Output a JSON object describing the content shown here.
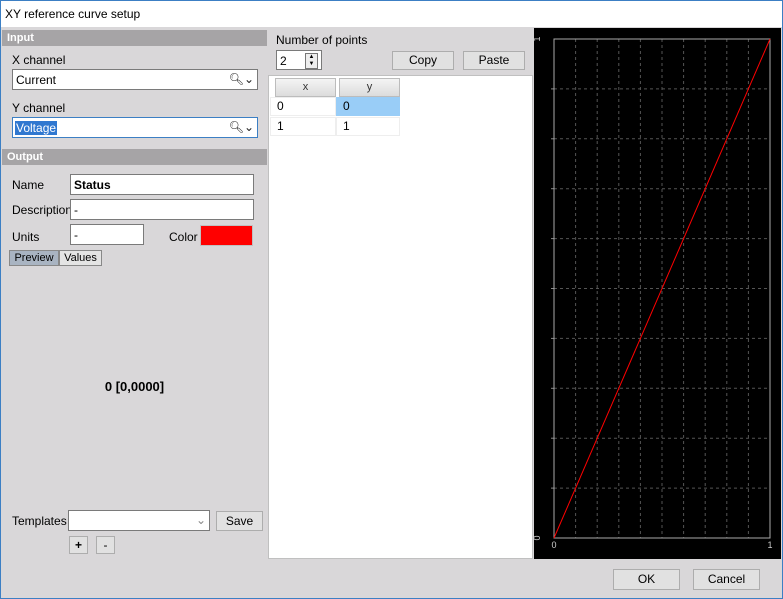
{
  "window": {
    "title": "XY reference curve setup"
  },
  "input_section": {
    "header": "Input",
    "x_channel": {
      "label": "X channel",
      "value": "Current"
    },
    "y_channel": {
      "label": "Y channel",
      "value": "Voltage"
    }
  },
  "output_section": {
    "header": "Output",
    "name": {
      "label": "Name",
      "value": "Status"
    },
    "description": {
      "label": "Description",
      "value": "-"
    },
    "units": {
      "label": "Units",
      "value": "-"
    },
    "color": {
      "label": "Color",
      "value": "#ff0000"
    },
    "tabs": [
      {
        "label": "Preview",
        "active": true
      },
      {
        "label": "Values",
        "active": false
      }
    ],
    "preview_value": "0 [0,0000]"
  },
  "templates": {
    "label": "Templates",
    "value": "",
    "save_label": "Save",
    "add_label": "+",
    "remove_label": "-"
  },
  "points": {
    "label": "Number of points",
    "count": "2",
    "copy_label": "Copy",
    "paste_label": "Paste",
    "columns": [
      "x",
      "y"
    ],
    "rows": [
      [
        "0",
        "0"
      ],
      [
        "1",
        "1"
      ]
    ]
  },
  "chart_data": {
    "type": "line",
    "series": [
      {
        "name": "Status",
        "color": "#ff0000",
        "x": [
          0,
          1
        ],
        "y": [
          0,
          1
        ]
      }
    ],
    "x_ticks": [
      "0",
      "1"
    ],
    "y_ticks": [
      "0",
      "1"
    ],
    "xlim": [
      0,
      1
    ],
    "ylim": [
      0,
      1
    ],
    "grid": true,
    "background": "#000000"
  },
  "footer": {
    "ok_label": "OK",
    "cancel_label": "Cancel"
  }
}
